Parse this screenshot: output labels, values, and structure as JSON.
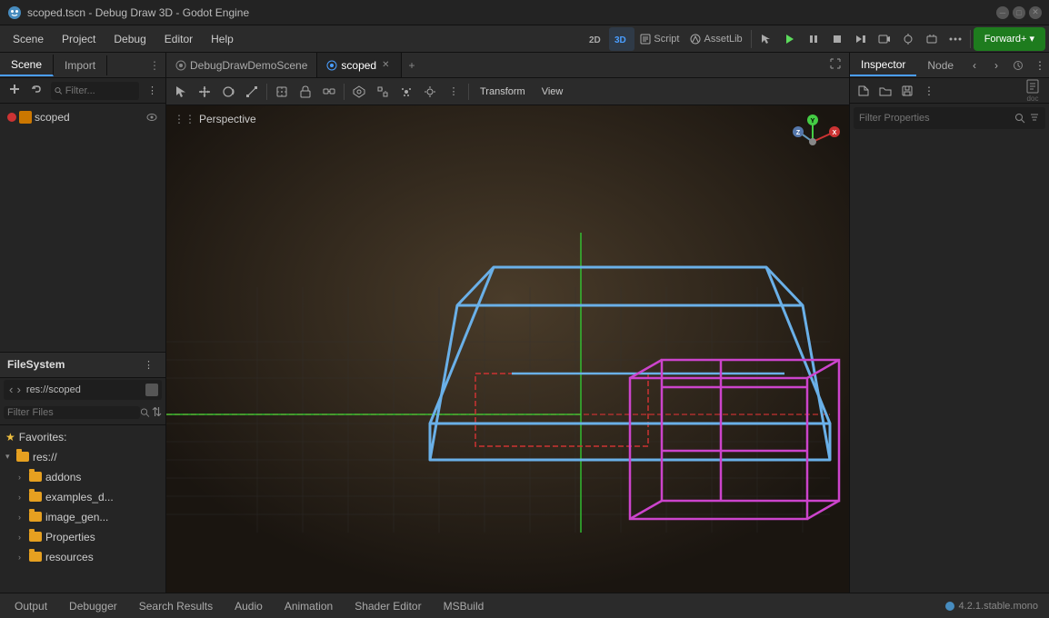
{
  "titlebar": {
    "title": "scoped.tscn - Debug Draw 3D - Godot Engine",
    "min_label": "─",
    "max_label": "□",
    "close_label": "✕"
  },
  "menubar": {
    "items": [
      "Scene",
      "Project",
      "Debug",
      "Editor",
      "Help"
    ]
  },
  "toolbar": {
    "mode_2d": "2D",
    "mode_3d": "3D",
    "script": "Script",
    "assetlib": "AssetLib",
    "forward_plus": "Forward+",
    "transform_label": "Transform",
    "view_label": "View"
  },
  "scene_panel": {
    "tabs": [
      "Scene",
      "Import"
    ],
    "filter_placeholder": "Filter...",
    "tree_items": [
      {
        "label": "scoped",
        "type": "root"
      }
    ]
  },
  "filesystem": {
    "title": "FileSystem",
    "path": "res://scoped",
    "filter_placeholder": "Filter Files",
    "items": [
      {
        "label": "Favorites:",
        "type": "favorites",
        "indent": 0
      },
      {
        "label": "res://",
        "type": "folder",
        "indent": 0,
        "expanded": true
      },
      {
        "label": "addons",
        "type": "folder",
        "indent": 1
      },
      {
        "label": "examples_d...",
        "type": "folder",
        "indent": 1
      },
      {
        "label": "image_gen...",
        "type": "folder",
        "indent": 1
      },
      {
        "label": "Properties",
        "type": "folder",
        "indent": 1
      },
      {
        "label": "resources",
        "type": "folder",
        "indent": 1
      }
    ]
  },
  "editor_tabs": {
    "tabs": [
      {
        "label": "DebugDrawDemoScene",
        "has_close": false,
        "dirty": true
      },
      {
        "label": "scoped",
        "has_close": true,
        "dirty": false,
        "active": true
      }
    ]
  },
  "viewport": {
    "perspective_label": "Perspective",
    "toolbar_buttons": [
      "select",
      "move",
      "rotate",
      "scale",
      "transform_mode",
      "lock",
      "group",
      "mesh",
      "snap",
      "more"
    ],
    "transform_label": "Transform",
    "view_label": "View"
  },
  "inspector": {
    "tabs": [
      "Inspector",
      "Node"
    ],
    "filter_placeholder": "Filter Properties"
  },
  "bottom_bar": {
    "tabs": [
      "Output",
      "Debugger",
      "Search Results",
      "Audio",
      "Animation",
      "Shader Editor",
      "MSBuild"
    ],
    "version": "4.2.1.stable.mono"
  }
}
